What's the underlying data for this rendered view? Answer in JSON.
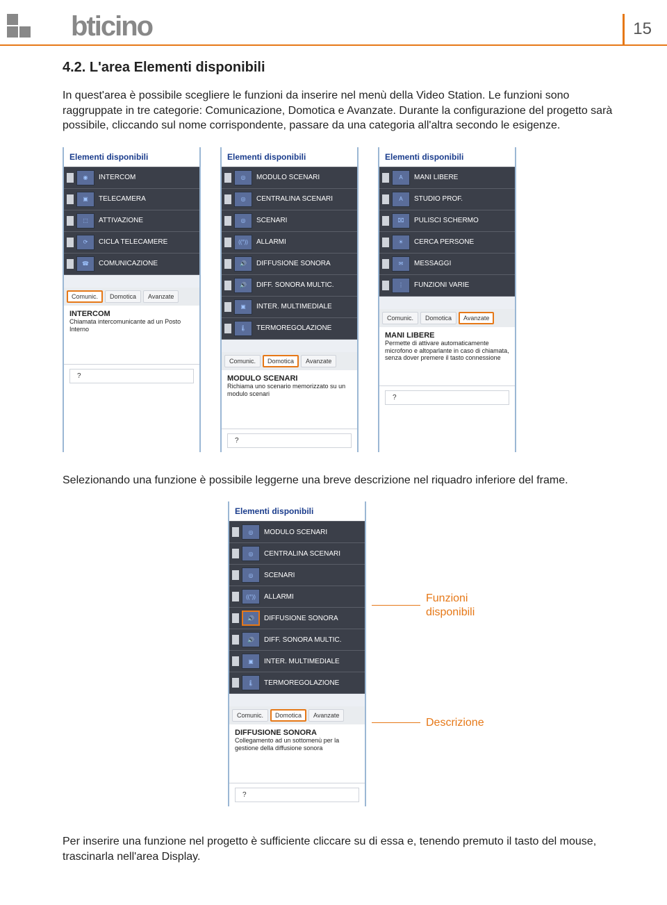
{
  "page_number": "15",
  "brand": "bticino",
  "section_number": "4.2.",
  "section_title": "L'area Elementi disponibili",
  "paragraph1": "In quest'area è possibile scegliere le funzioni da inserire nel menù della Video Station. Le funzioni sono raggruppate in tre categorie: Comunicazione, Domotica e Avanzate. Durante la configurazione del progetto sarà possibile, cliccando sul nome corrispondente, passare da una categoria all'altra secondo le esigenze.",
  "paragraph2": "Selezionando una funzione è possibile leggerne una breve descrizione nel riquadro inferiore del frame.",
  "paragraph3": "Per inserire una funzione nel progetto è sufficiente cliccare su di essa e, tenendo premuto il tasto del mouse, trascinarla nell'area Display.",
  "panel_header": "Elementi disponibili",
  "tabs": {
    "comunic": "Comunic.",
    "domotica": "Domotica",
    "avanzate": "Avanzate"
  },
  "help_placeholder": "?",
  "callouts": {
    "funzioni": "Funzioni disponibili",
    "descrizione": "Descrizione"
  },
  "panel1": {
    "items": [
      "INTERCOM",
      "TELECAMERA",
      "ATTIVAZIONE",
      "CICLA TELECAMERE",
      "COMUNICAZIONE"
    ],
    "desc_title": "INTERCOM",
    "desc_text": "Chiamata intercomunicante ad un Posto Interno"
  },
  "panel2": {
    "items": [
      "MODULO SCENARI",
      "CENTRALINA SCENARI",
      "SCENARI",
      "ALLARMI",
      "DIFFUSIONE SONORA",
      "DIFF. SONORA MULTIC.",
      "INTER. MULTIMEDIALE",
      "TERMOREGOLAZIONE"
    ],
    "desc_title": "MODULO SCENARI",
    "desc_text": "Richiama uno scenario memorizzato su un modulo scenari"
  },
  "panel3": {
    "items": [
      "MANI LIBERE",
      "STUDIO PROF.",
      "PULISCI SCHERMO",
      "CERCA PERSONE",
      "MESSAGGI",
      "FUNZIONI VARIE"
    ],
    "desc_title": "MANI LIBERE",
    "desc_text": "Permette di attivare automaticamente microfono e altoparlante in caso di chiamata, senza dover premere il tasto connessione"
  },
  "panel4": {
    "items": [
      "MODULO SCENARI",
      "CENTRALINA SCENARI",
      "SCENARI",
      "ALLARMI",
      "DIFFUSIONE SONORA",
      "DIFF. SONORA MULTIC.",
      "INTER. MULTIMEDIALE",
      "TERMOREGOLAZIONE"
    ],
    "desc_title": "DIFFUSIONE SONORA",
    "desc_text": "Collegamento ad un sottomenù per la gestione della diffusione sonora"
  }
}
